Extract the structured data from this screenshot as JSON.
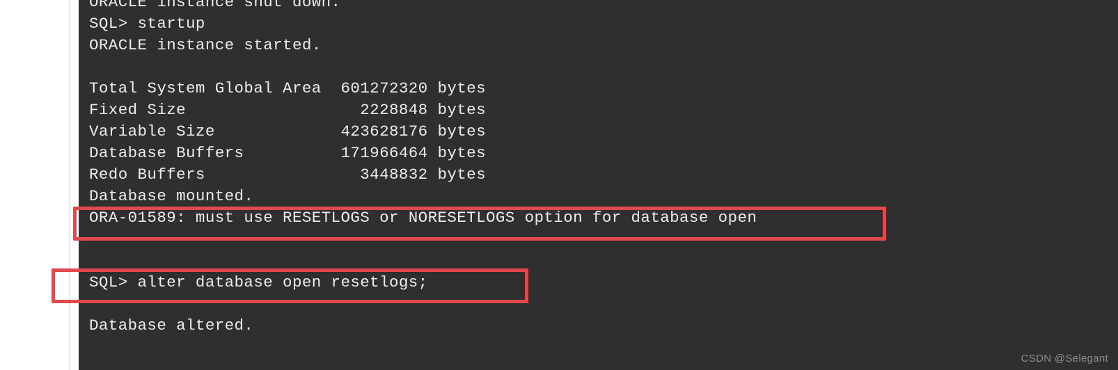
{
  "terminal": {
    "background_color": "#2f2f2f",
    "text_color": "#ececec",
    "lines": [
      {
        "id": "l0",
        "text": "ORACLE instance shut down."
      },
      {
        "id": "l1",
        "text": "SQL> startup"
      },
      {
        "id": "l2",
        "text": "ORACLE instance started."
      },
      {
        "id": "l3",
        "text": ""
      },
      {
        "id": "l4",
        "text": "Total System Global Area  601272320 bytes"
      },
      {
        "id": "l5",
        "text": "Fixed Size                  2228848 bytes"
      },
      {
        "id": "l6",
        "text": "Variable Size             423628176 bytes"
      },
      {
        "id": "l7",
        "text": "Database Buffers          171966464 bytes"
      },
      {
        "id": "l8",
        "text": "Redo Buffers                3448832 bytes"
      },
      {
        "id": "l9",
        "text": "Database mounted."
      },
      {
        "id": "l10",
        "text": "ORA-01589: must use RESETLOGS or NORESETLOGS option for database open"
      },
      {
        "id": "l11",
        "text": ""
      },
      {
        "id": "l12",
        "text": ""
      },
      {
        "id": "l13",
        "text": "SQL> alter database open resetlogs;"
      },
      {
        "id": "l14",
        "text": ""
      },
      {
        "id": "l15",
        "text": "Database altered."
      },
      {
        "id": "l16",
        "text": ""
      }
    ],
    "memory_report": {
      "rows": [
        {
          "label": "Total System Global Area",
          "value": "601272320",
          "unit": "bytes"
        },
        {
          "label": "Fixed Size",
          "value": "2228848",
          "unit": "bytes"
        },
        {
          "label": "Variable Size",
          "value": "423628176",
          "unit": "bytes"
        },
        {
          "label": "Database Buffers",
          "value": "171966464",
          "unit": "bytes"
        },
        {
          "label": "Redo Buffers",
          "value": "3448832",
          "unit": "bytes"
        }
      ]
    },
    "commands": [
      {
        "prompt": "SQL>",
        "text": "startup"
      },
      {
        "prompt": "SQL>",
        "text": "alter database open resetlogs;"
      }
    ],
    "error": {
      "code": "ORA-01589",
      "message": "must use RESETLOGS or NORESETLOGS option for database open"
    }
  },
  "annotations": {
    "color": "#e04a4e",
    "boxes": [
      {
        "id": "error-highlight",
        "target": "ORA-01589: must use RESETLOGS or NORESETLOGS option for database open"
      },
      {
        "id": "command-highlight",
        "target": "SQL> alter database open resetlogs;"
      }
    ]
  },
  "watermark": {
    "text": "CSDN @Selegant",
    "color": "#8c8c8c"
  }
}
